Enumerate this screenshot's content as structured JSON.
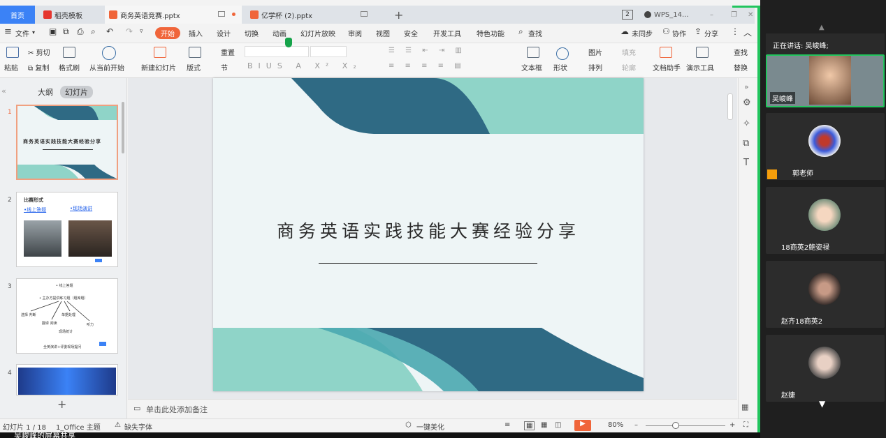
{
  "tabs": {
    "home": "首页",
    "template": "稻壳模板",
    "doc1": "商务英语竞赛.pptx",
    "doc2": "亿学杯 (2).pptx",
    "badge": "2",
    "wps": "WPS_14..."
  },
  "menu": {
    "file": "文件",
    "start": "开始",
    "insert": "插入",
    "design": "设计",
    "transition": "切换",
    "animation": "动画",
    "slideshow": "幻灯片放映",
    "review": "审阅",
    "view": "视图",
    "security": "安全",
    "devtools": "开发工具",
    "special": "特色功能",
    "search": "查找",
    "unsync": "未同步",
    "collab": "协作",
    "share": "分享"
  },
  "ribbon": {
    "paste": "粘贴",
    "cut": "剪切",
    "copy": "复制",
    "format_painter": "格式刷",
    "from_current": "从当前开始",
    "new_slide": "新建幻灯片",
    "layout": "版式",
    "reset": "重置",
    "section": "节",
    "textbox": "文本框",
    "shape": "形状",
    "picture": "图片",
    "fill": "填充",
    "arrange": "排列",
    "outline": "轮廓",
    "doc_assistant": "文档助手",
    "presenter": "演示工具",
    "find": "查找",
    "replace": "替换"
  },
  "panel": {
    "outline_tab": "大纲",
    "slides_tab": "幻灯片",
    "add": "+"
  },
  "thumbs": {
    "t1": {
      "num": "1",
      "title": "商务英语实践技能大赛经验分享"
    },
    "t2": {
      "num": "2",
      "title": "比赛形式",
      "item1": "•线上答题",
      "item2": "•现场演讲"
    },
    "t3": {
      "num": "3",
      "l1": "• 线上答题",
      "l2": "• 主办方提供练习题（题库题）",
      "l3": "选择 判断",
      "l4": "单据处理",
      "l5": "翻译 阅读",
      "l6": "听力",
      "l7": "现场统计",
      "l8": "全英演讲+评委现场提问"
    },
    "t4": {
      "num": "4"
    }
  },
  "slide": {
    "title": "商务英语实践技能大赛经验分享"
  },
  "notes": "单击此处添加备注",
  "status": {
    "slide_count": "幻灯片 1 / 18",
    "theme": "1_Office 主题",
    "missing_font": "缺失字体",
    "beautify": "一键美化",
    "zoom": "80%"
  },
  "screen_share_label": "吴峻峰的屏幕共享",
  "meeting": {
    "speaking": "正在讲话: 吴峻峰;",
    "participants": [
      "吴峻峰",
      "郭老师",
      "18商英2鲍姿禄",
      "赵齐18商英2",
      "赵婕"
    ]
  },
  "colors": {
    "accent_orange": "#f0653a",
    "slide_dark": "#2f6a84",
    "slide_light": "#8fd4c8",
    "green_border": "#22c55e"
  }
}
